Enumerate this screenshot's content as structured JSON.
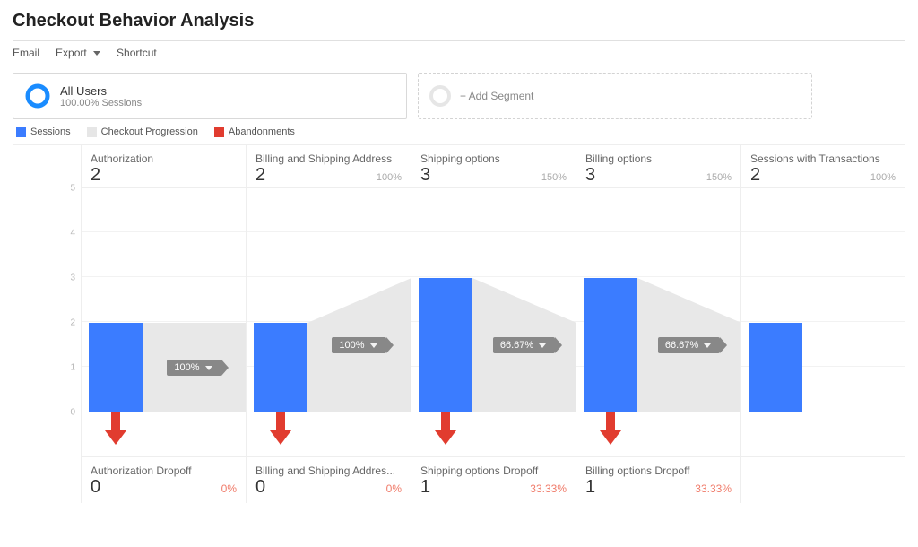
{
  "page_title": "Checkout Behavior Analysis",
  "toolbar": {
    "email": "Email",
    "export": "Export",
    "shortcut": "Shortcut"
  },
  "segments": {
    "primary": {
      "title": "All Users",
      "sub": "100.00% Sessions"
    },
    "add_label": "+ Add Segment"
  },
  "legend": {
    "sessions": "Sessions",
    "progression": "Checkout Progression",
    "abandonments": "Abandonments"
  },
  "axis": {
    "max": 5,
    "ticks": [
      0,
      1,
      2,
      3,
      4,
      5
    ]
  },
  "colors": {
    "sessions": "#3b7cff",
    "progression": "#e6e6e6",
    "abandonments": "#e13c2f"
  },
  "steps": [
    {
      "name": "Authorization",
      "value": 2,
      "pct": "",
      "progression_pct": "100%",
      "progression_to": 2,
      "dropoff_name": "Authorization Dropoff",
      "dropoff_value": 0,
      "dropoff_pct": "0%"
    },
    {
      "name": "Billing and Shipping Address",
      "value": 2,
      "pct": "100%",
      "progression_pct": "100%",
      "progression_to": 3,
      "dropoff_name": "Billing and Shipping Addres...",
      "dropoff_value": 0,
      "dropoff_pct": "0%"
    },
    {
      "name": "Shipping options",
      "value": 3,
      "pct": "150%",
      "progression_pct": "66.67%",
      "progression_to": 2,
      "dropoff_name": "Shipping options Dropoff",
      "dropoff_value": 1,
      "dropoff_pct": "33.33%"
    },
    {
      "name": "Billing options",
      "value": 3,
      "pct": "150%",
      "progression_pct": "66.67%",
      "progression_to": 2,
      "dropoff_name": "Billing options Dropoff",
      "dropoff_value": 1,
      "dropoff_pct": "33.33%"
    },
    {
      "name": "Sessions with Transactions",
      "value": 2,
      "pct": "100%",
      "progression_pct": null,
      "progression_to": null,
      "dropoff_name": null,
      "dropoff_value": null,
      "dropoff_pct": null
    }
  ],
  "chart_data": {
    "type": "bar",
    "title": "Checkout Behavior Analysis",
    "ylabel": "Sessions",
    "xlabel": "",
    "ylim": [
      0,
      5
    ],
    "categories": [
      "Authorization",
      "Billing and Shipping Address",
      "Shipping options",
      "Billing options",
      "Sessions with Transactions"
    ],
    "series": [
      {
        "name": "Sessions (blue bar)",
        "values": [
          2,
          2,
          3,
          3,
          2
        ]
      },
      {
        "name": "Progression % to next step",
        "values": [
          100,
          100,
          66.67,
          66.67,
          null
        ]
      },
      {
        "name": "Abandonments",
        "values": [
          0,
          0,
          1,
          1,
          null
        ]
      },
      {
        "name": "Abandonment %",
        "values": [
          0,
          0,
          33.33,
          33.33,
          null
        ]
      }
    ],
    "annotations": {
      "step_header_pct": [
        null,
        "100%",
        "150%",
        "150%",
        "100%"
      ]
    }
  }
}
